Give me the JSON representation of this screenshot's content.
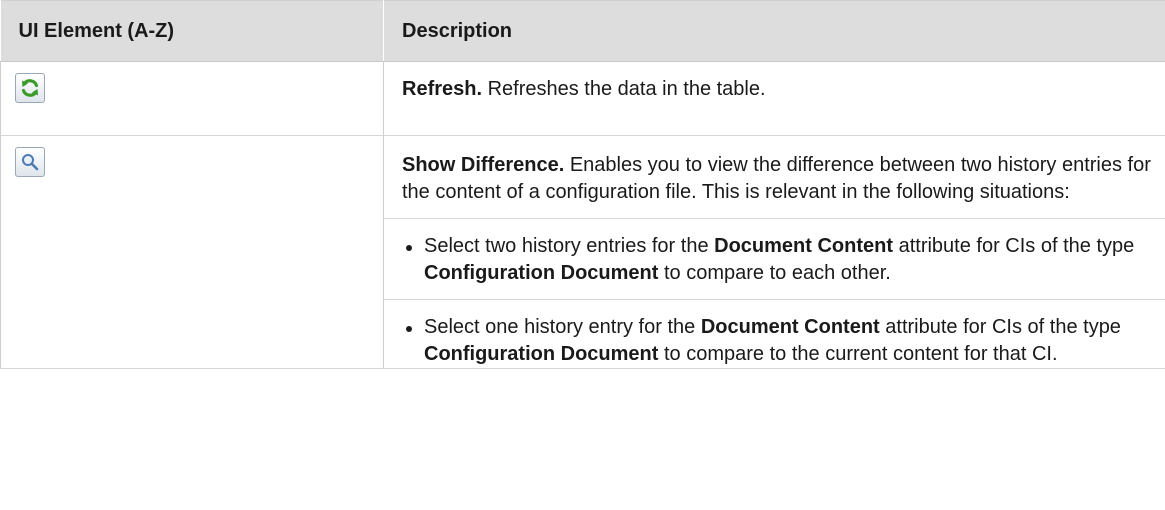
{
  "table": {
    "headers": {
      "element": "UI Element (A-Z)",
      "description": "Description"
    },
    "rows": [
      {
        "icon": "refresh-icon",
        "title": "Refresh.",
        "text": " Refreshes the data in the table."
      },
      {
        "icon": "magnifier-icon",
        "title": "Show Difference.",
        "text": " Enables you to view the difference between two history entries for the content of a configuration file. This is relevant in the following situations:",
        "bullets": [
          {
            "t1": "Select two history entries for the ",
            "b1": "Document Content",
            "t2": " attribute for CIs of the type ",
            "b2": "Configuration Document",
            "t3": " to compare to each other."
          },
          {
            "t1": "Select one history entry for the ",
            "b1": "Document Content",
            "t2": " attribute for CIs of the type ",
            "b2": "Configuration Document",
            "t3": " to compare to the current content for that CI."
          }
        ]
      }
    ]
  },
  "colors": {
    "header_bg": "#dddddd",
    "icon_green": "#3a9a2a",
    "icon_blue": "#4d7bb3"
  }
}
